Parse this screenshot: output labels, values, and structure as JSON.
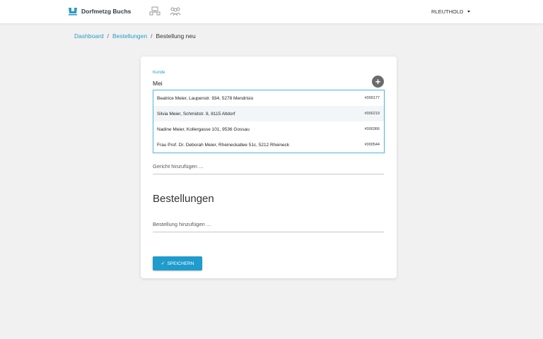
{
  "header": {
    "brand": "Dorfmetzg Buchs",
    "user": "RLEUTHOLD",
    "icons": [
      "store-icon",
      "people-icon"
    ]
  },
  "breadcrumb": {
    "items": [
      "Dashboard",
      "Bestellungen"
    ],
    "current": "Bestellung neu",
    "separator": "/"
  },
  "form": {
    "kunde_label": "Kunde",
    "kunde_value": "Mei",
    "suggestions": [
      {
        "name": "Beatrice Meier, Laupenstr. 934, 5278 Mendrisio",
        "id": "#000177"
      },
      {
        "name": "Silvia Meier, Schmidstr. 8, 8115 Altdorf",
        "id": "#000219"
      },
      {
        "name": "Nadine Meier, Kollergasse 101, 9536 Gossau",
        "id": "#000366"
      },
      {
        "name": "Frau Prof. Dr. Deborah Meier, Rheineckallee 51c, 5212 Rheineck",
        "id": "#000544"
      }
    ],
    "gericht_placeholder": "Gericht hinzufügen ...",
    "section_title": "Bestellungen",
    "bestellung_placeholder": "Bestellung hinzufügen ...",
    "save_label": "SPEICHERN",
    "add_symbol": "+"
  },
  "colors": {
    "accent": "#2a9ac4",
    "button": "#1f9bcc",
    "background": "#f1f1f1"
  }
}
